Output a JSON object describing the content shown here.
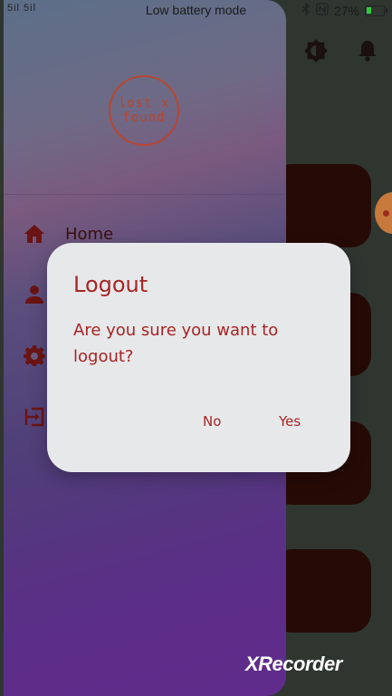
{
  "status_bar": {
    "signal": "5il 5il",
    "mode": "Low battery mode",
    "battery_percent": "27%",
    "battery_level": 0.27
  },
  "drawer": {
    "logo_line1": "lost x",
    "logo_line2": "found",
    "items": [
      {
        "label": "Home",
        "icon": "home-icon"
      },
      {
        "label": "",
        "icon": "person-icon"
      },
      {
        "label": "",
        "icon": "settings-icon"
      },
      {
        "label": "",
        "icon": "logout-icon"
      }
    ]
  },
  "dialog": {
    "title": "Logout",
    "message": "Are you sure you want to logout?",
    "no_label": "No",
    "yes_label": "Yes"
  },
  "watermark": "XRecorder",
  "colors": {
    "accent": "#a82424",
    "dialog_bg": "#e7e8ea",
    "card": "#260a06"
  }
}
